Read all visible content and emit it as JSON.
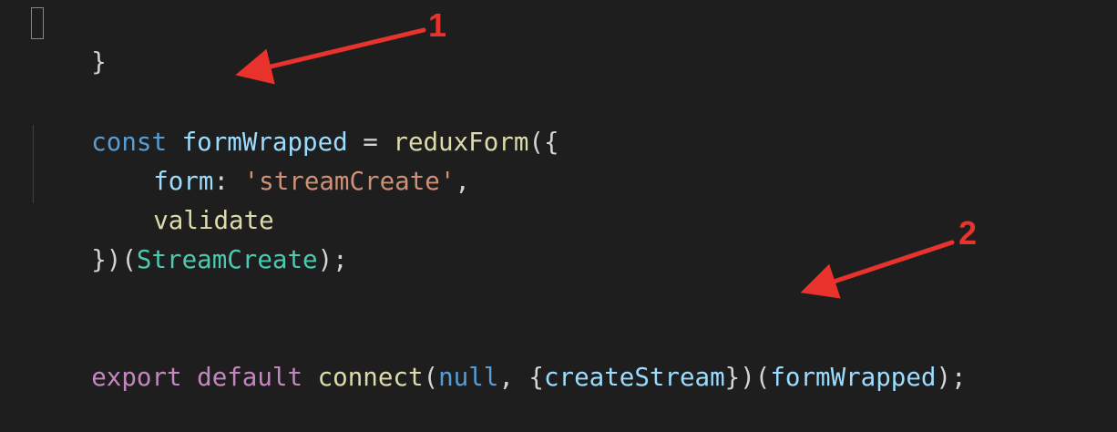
{
  "theme": {
    "background": "#1e1e1e",
    "colors": {
      "keyword_decl": "#569cd6",
      "keyword_control": "#c586c0",
      "variable": "#9cdcfe",
      "function": "#dcdcaa",
      "string": "#ce9178",
      "class": "#4ec9b0",
      "punctuation": "#d4d4d4",
      "literal": "#569cd6",
      "annotation": "#e8322c"
    }
  },
  "code": {
    "line1": {
      "brace": "}"
    },
    "line2": {
      "kw": "const",
      "name": "formWrapped",
      "eq": " = ",
      "fn": "reduxForm",
      "open": "({"
    },
    "line3": {
      "prop": "form",
      "colon": ": ",
      "str": "'streamCreate'",
      "comma": ","
    },
    "line4": {
      "prop": "validate"
    },
    "line5": {
      "close": "})(",
      "cls": "StreamCreate",
      "end": ");"
    },
    "line6": {
      "kw1": "export",
      "kw2": "default",
      "fn": "connect",
      "open": "(",
      "null": "null",
      "sep": ", {",
      "arg": "createStream",
      "mid": "})(",
      "ref": "formWrapped",
      "end": ");"
    }
  },
  "annotations": {
    "marker1": "1",
    "marker2": "2"
  }
}
